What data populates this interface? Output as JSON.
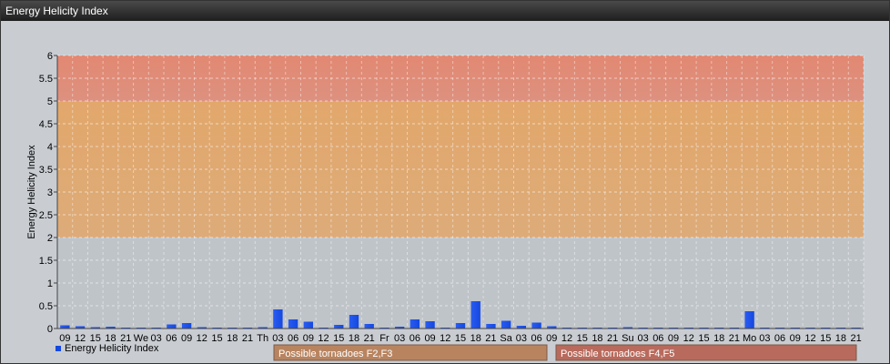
{
  "window": {
    "title": "Energy Helicity Index"
  },
  "chart_data": {
    "type": "bar",
    "ylabel": "Energy Helicity Index",
    "ylim": [
      0,
      6
    ],
    "yticks": [
      "0",
      "0.5",
      "1",
      "1.5",
      "2",
      "2.5",
      "3",
      "3.5",
      "4",
      "4.5",
      "5",
      "5.5",
      "6"
    ],
    "grid": true,
    "categories": [
      "09",
      "12",
      "15",
      "18",
      "21",
      "We",
      "03",
      "06",
      "09",
      "12",
      "15",
      "18",
      "21",
      "Th",
      "03",
      "06",
      "09",
      "12",
      "15",
      "18",
      "21",
      "Fr",
      "03",
      "06",
      "09",
      "12",
      "15",
      "18",
      "21",
      "Sa",
      "03",
      "06",
      "09",
      "12",
      "15",
      "18",
      "21",
      "Su",
      "03",
      "06",
      "09",
      "12",
      "15",
      "18",
      "21",
      "Mo",
      "03",
      "06",
      "09",
      "12",
      "15",
      "18",
      "21"
    ],
    "series": [
      {
        "name": "Energy Helicity Index",
        "color": "#1548e0",
        "values": [
          0.07,
          0.05,
          0.03,
          0.04,
          0.02,
          0.02,
          0.02,
          0.09,
          0.12,
          0.03,
          0.02,
          0.02,
          0.02,
          0.03,
          0.42,
          0.2,
          0.15,
          0.02,
          0.08,
          0.3,
          0.1,
          0.02,
          0.04,
          0.2,
          0.16,
          0.02,
          0.12,
          0.6,
          0.1,
          0.17,
          0.06,
          0.13,
          0.05,
          0.02,
          0.02,
          0.02,
          0.02,
          0.03,
          0.02,
          0.02,
          0.02,
          0.02,
          0.02,
          0.02,
          0.02,
          0.38,
          0.02,
          0.02,
          0.02,
          0.02,
          0.02,
          0.02,
          0.02
        ]
      }
    ],
    "bands": [
      {
        "label": "Possible tornadoes F2,F3",
        "from": 2,
        "to": 5,
        "color": "#e2a76b",
        "label_color": "#b88460"
      },
      {
        "label": "Possible tornadoes F4,F5",
        "from": 5,
        "to": 6,
        "color": "#e28872",
        "label_color": "#b86a5c"
      }
    ],
    "legend": {
      "position": "bottom-left"
    }
  }
}
